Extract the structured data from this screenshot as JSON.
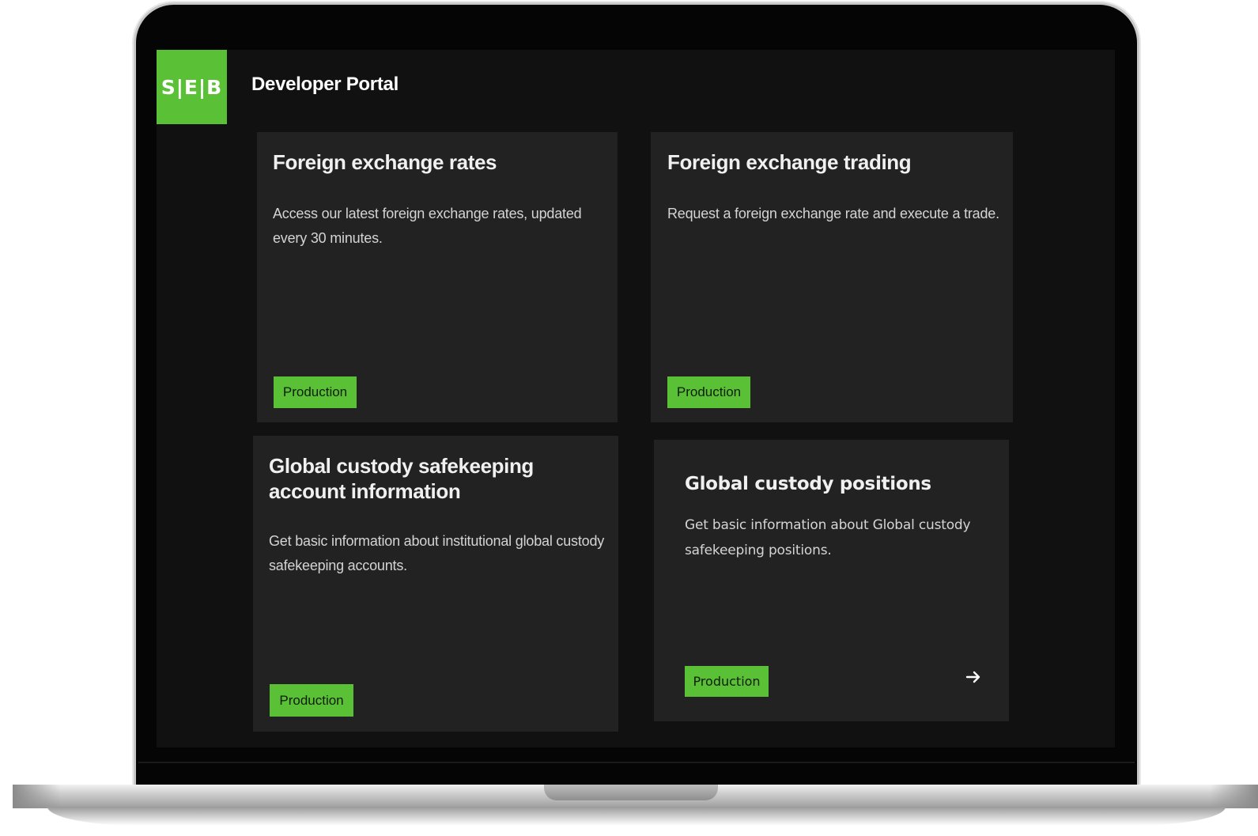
{
  "header": {
    "logo_text": "S|E|B",
    "portal_title": "Developer Portal"
  },
  "cards": [
    {
      "title": "Foreign exchange rates",
      "description": "Access our latest foreign exchange rates, updated every 30 minutes.",
      "status": "Production"
    },
    {
      "title": "Foreign exchange trading",
      "description": "Request a foreign exchange rate and execute a trade.",
      "status": "Production"
    },
    {
      "title": "Global custody safekeeping account information",
      "description": "Get basic information about institutional global custody safekeeping accounts.",
      "status": "Production"
    },
    {
      "title": "Global custody positions",
      "description": "Get basic information about Global custody safekeeping positions.",
      "status": "Production",
      "action_icon": "arrow-right-icon"
    }
  ],
  "colors": {
    "brand_green": "#5ac136",
    "screen_bg": "#111111",
    "card_bg": "#222222"
  }
}
